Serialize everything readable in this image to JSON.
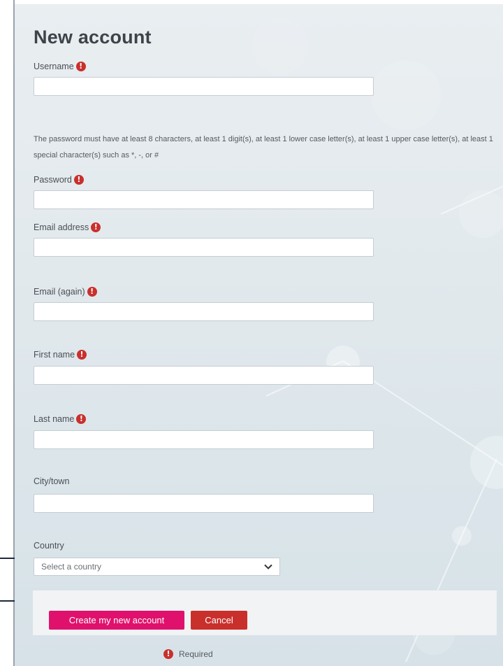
{
  "page_title": "New account",
  "required_symbol": "!",
  "fields": {
    "username": {
      "label": "Username",
      "value": "",
      "placeholder": ""
    },
    "password_help": "The password must have at least 8 characters, at least 1 digit(s), at least 1 lower case letter(s), at least 1 upper case letter(s), at least 1 special character(s) such as *, -, or #",
    "password": {
      "label": "Password",
      "value": "",
      "placeholder": ""
    },
    "email": {
      "label": "Email address",
      "value": "",
      "placeholder": ""
    },
    "email_again": {
      "label": "Email (again)",
      "value": "",
      "placeholder": ""
    },
    "first_name": {
      "label": "First name",
      "value": "",
      "placeholder": ""
    },
    "last_name": {
      "label": "Last name",
      "value": "",
      "placeholder": ""
    },
    "city": {
      "label": "City/town",
      "value": "",
      "placeholder": ""
    },
    "country": {
      "label": "Country",
      "selected": "Select a country"
    }
  },
  "actions": {
    "create_label": "Create my new account",
    "cancel_label": "Cancel"
  },
  "required_note": "Required",
  "icons": {
    "required": "exclamation-circle-icon",
    "dropdown": "chevron-down-icon"
  },
  "colors": {
    "primary_button": "#e0116d",
    "cancel_button": "#c9302c",
    "required_icon": "#c9302c",
    "title": "#3e4349"
  }
}
